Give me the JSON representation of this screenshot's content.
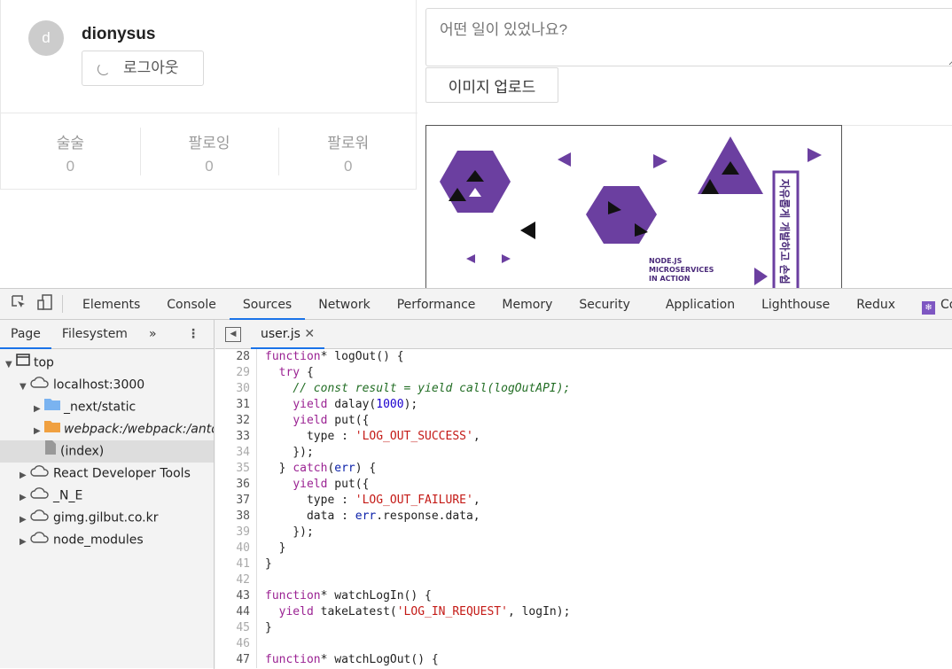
{
  "profile": {
    "avatar_letter": "d",
    "username": "dionysus",
    "logout_label": "로그아웃",
    "stats": [
      {
        "label": "술술",
        "value": "0"
      },
      {
        "label": "팔로잉",
        "value": "0"
      },
      {
        "label": "팔로워",
        "value": "0"
      }
    ]
  },
  "post_form": {
    "placeholder": "어떤 일이 있었나요?",
    "upload_label": "이미지 업로드"
  },
  "cover": {
    "title_lines": [
      "NODE.JS",
      "MICROSERVICES",
      "IN ACTION"
    ],
    "korean_text": "자유롭게 개발하고 손쉽",
    "accent": "#6b3fa0"
  },
  "devtools": {
    "tabs": [
      "Elements",
      "Console",
      "Sources",
      "Network",
      "Performance",
      "Memory",
      "Security",
      "Application",
      "Lighthouse",
      "Redux",
      "Comp"
    ],
    "active_tab": "Sources",
    "subtabs": [
      "Page",
      "Filesystem"
    ],
    "tree": [
      {
        "label": "top",
        "level": 0,
        "expanded": true,
        "icon": "frame-icon"
      },
      {
        "label": "localhost:3000",
        "level": 1,
        "expanded": true,
        "icon": "cloud-icon"
      },
      {
        "label": "_next/static",
        "level": 2,
        "expanded": false,
        "icon": "folder-blue-icon"
      },
      {
        "label": "webpack:/webpack:/antd/",
        "level": 2,
        "expanded": false,
        "icon": "folder-orange-icon",
        "italic": true
      },
      {
        "label": "(index)",
        "level": 2,
        "icon": "file-icon",
        "selected": true
      },
      {
        "label": "React Developer Tools",
        "level": 1,
        "expanded": false,
        "icon": "cloud-icon"
      },
      {
        "label": "_N_E",
        "level": 1,
        "expanded": false,
        "icon": "cloud-icon"
      },
      {
        "label": "gimg.gilbut.co.kr",
        "level": 1,
        "expanded": false,
        "icon": "cloud-icon"
      },
      {
        "label": "node_modules",
        "level": 1,
        "expanded": false,
        "icon": "cloud-icon"
      }
    ],
    "open_file": "user.js",
    "code": [
      {
        "n": 28,
        "t": [
          [
            "kw",
            "function"
          ],
          [
            "",
            "* logOut() {"
          ]
        ]
      },
      {
        "n": 29,
        "d": 1,
        "t": [
          [
            "",
            "  "
          ],
          [
            "kw",
            "try"
          ],
          [
            "",
            " {"
          ]
        ]
      },
      {
        "n": 30,
        "d": 1,
        "t": [
          [
            "",
            "    "
          ],
          [
            "cm",
            "// const result = yield call(logOutAPI);"
          ]
        ]
      },
      {
        "n": 31,
        "t": [
          [
            "",
            "    "
          ],
          [
            "kw",
            "yield"
          ],
          [
            "",
            " dalay("
          ],
          [
            "nm",
            "1000"
          ],
          [
            "",
            ");"
          ]
        ]
      },
      {
        "n": 32,
        "t": [
          [
            "",
            "    "
          ],
          [
            "kw",
            "yield"
          ],
          [
            "",
            " put({"
          ]
        ]
      },
      {
        "n": 33,
        "t": [
          [
            "",
            "      type : "
          ],
          [
            "str",
            "'LOG_OUT_SUCCESS'"
          ],
          [
            "",
            ","
          ]
        ]
      },
      {
        "n": 34,
        "d": 1,
        "t": [
          [
            "",
            "    });"
          ]
        ]
      },
      {
        "n": 35,
        "d": 1,
        "t": [
          [
            "",
            "  } "
          ],
          [
            "kw",
            "catch"
          ],
          [
            "",
            "("
          ],
          [
            "var",
            "err"
          ],
          [
            "",
            ") {"
          ]
        ]
      },
      {
        "n": 36,
        "t": [
          [
            "",
            "    "
          ],
          [
            "kw",
            "yield"
          ],
          [
            "",
            " put({"
          ]
        ]
      },
      {
        "n": 37,
        "t": [
          [
            "",
            "      type : "
          ],
          [
            "str",
            "'LOG_OUT_FAILURE'"
          ],
          [
            "",
            ","
          ]
        ]
      },
      {
        "n": 38,
        "t": [
          [
            "",
            "      data : "
          ],
          [
            "var",
            "err"
          ],
          [
            "",
            ".response.data,"
          ]
        ]
      },
      {
        "n": 39,
        "d": 1,
        "t": [
          [
            "",
            "    });"
          ]
        ]
      },
      {
        "n": 40,
        "d": 1,
        "t": [
          [
            "",
            "  }"
          ]
        ]
      },
      {
        "n": 41,
        "d": 1,
        "t": [
          [
            "",
            "}"
          ]
        ]
      },
      {
        "n": 42,
        "d": 1,
        "t": []
      },
      {
        "n": 43,
        "t": [
          [
            "kw",
            "function"
          ],
          [
            "",
            "* watchLogIn() {"
          ]
        ]
      },
      {
        "n": 44,
        "t": [
          [
            "",
            "  "
          ],
          [
            "kw",
            "yield"
          ],
          [
            "",
            " takeLatest("
          ],
          [
            "str",
            "'LOG_IN_REQUEST'"
          ],
          [
            "",
            ", logIn);"
          ]
        ]
      },
      {
        "n": 45,
        "d": 1,
        "t": [
          [
            "",
            "}"
          ]
        ]
      },
      {
        "n": 46,
        "d": 1,
        "t": []
      },
      {
        "n": 47,
        "t": [
          [
            "kw",
            "function"
          ],
          [
            "",
            "* watchLogOut() {"
          ]
        ]
      }
    ]
  }
}
